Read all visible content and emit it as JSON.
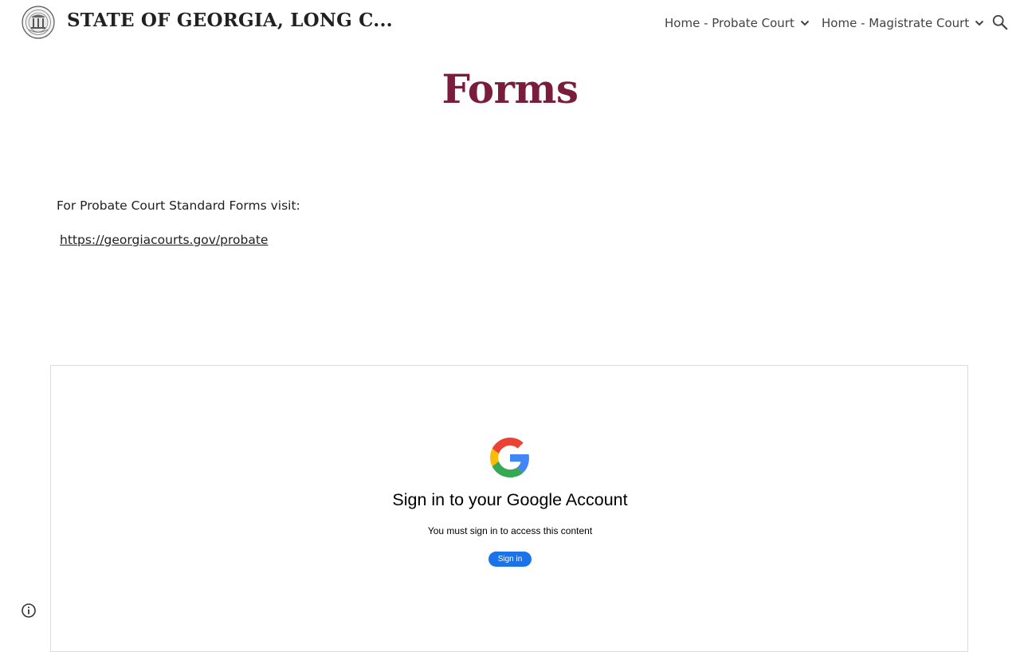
{
  "header": {
    "site_title": "STATE OF GEORGIA, LONG C...",
    "nav": [
      {
        "label": "Home - Probate Court",
        "icon": "chevron-down-icon"
      },
      {
        "label": "Home - Magistrate Court",
        "icon": "chevron-down-icon"
      }
    ],
    "search_icon": "search-icon",
    "logo_icon": "state-seal-logo"
  },
  "main": {
    "page_title": "Forms",
    "intro_text": "For Probate Court Standard Forms visit:",
    "link_text": "https://georgiacourts.gov/probate"
  },
  "embed": {
    "logo_icon": "google-g-logo",
    "heading": "Sign in to your Google Account",
    "subtext": "You must sign in to access this content",
    "button_label": "Sign in"
  },
  "footer": {
    "info_icon": "info-icon"
  },
  "colors": {
    "title": "#7a1d3c",
    "button": "#1a73e8",
    "text": "#212121"
  }
}
